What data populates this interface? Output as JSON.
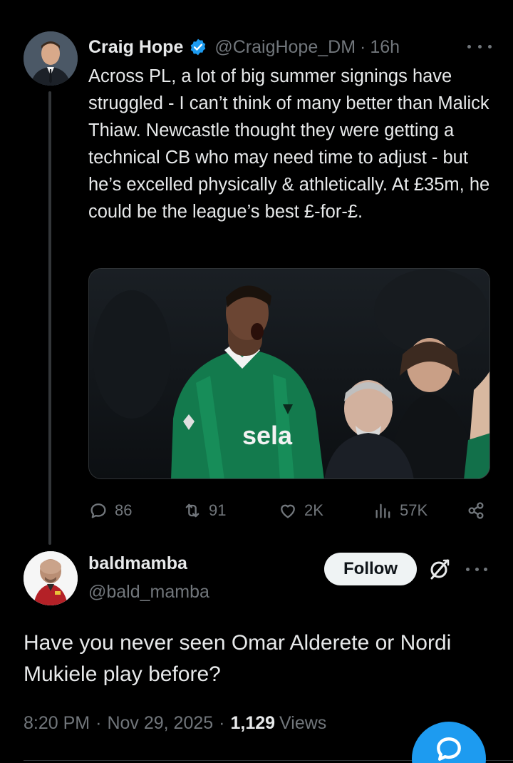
{
  "parent_tweet": {
    "display_name": "Craig Hope",
    "handle": "@CraigHope_DM",
    "separator": "·",
    "time": "16h",
    "text": "Across PL, a lot of big summer signings have struggled - I can’t think of many better than Malick Thiaw. Newcastle thought they were getting a technical CB who may need time to adjust - but he’s excelled physically & athletically. At £35m, he could be the league’s best £-for-£.",
    "media": {
      "shirt_sponsor": "sela"
    },
    "actions": {
      "replies": "86",
      "reposts": "91",
      "likes": "2K",
      "views": "57K"
    }
  },
  "reply_tweet": {
    "display_name": "baldmamba",
    "handle": "@bald_mamba",
    "follow_label": "Follow",
    "text": "Have you never seen Omar Alderete or Nordi Mukiele play before?",
    "time": "8:20 PM",
    "date": "Nov 29, 2025",
    "views_count": "1,129",
    "views_label": "Views",
    "separator": "·"
  },
  "colors": {
    "background": "#000000",
    "text_primary": "#e7e9ea",
    "text_secondary": "#71767b",
    "accent": "#1d9bf0",
    "follow_bg": "#eff3f4"
  },
  "icons": [
    "verified-badge-icon",
    "more-icon",
    "reply-icon",
    "repost-icon",
    "like-icon",
    "views-icon",
    "share-icon",
    "grok-icon",
    "compose-icon"
  ]
}
